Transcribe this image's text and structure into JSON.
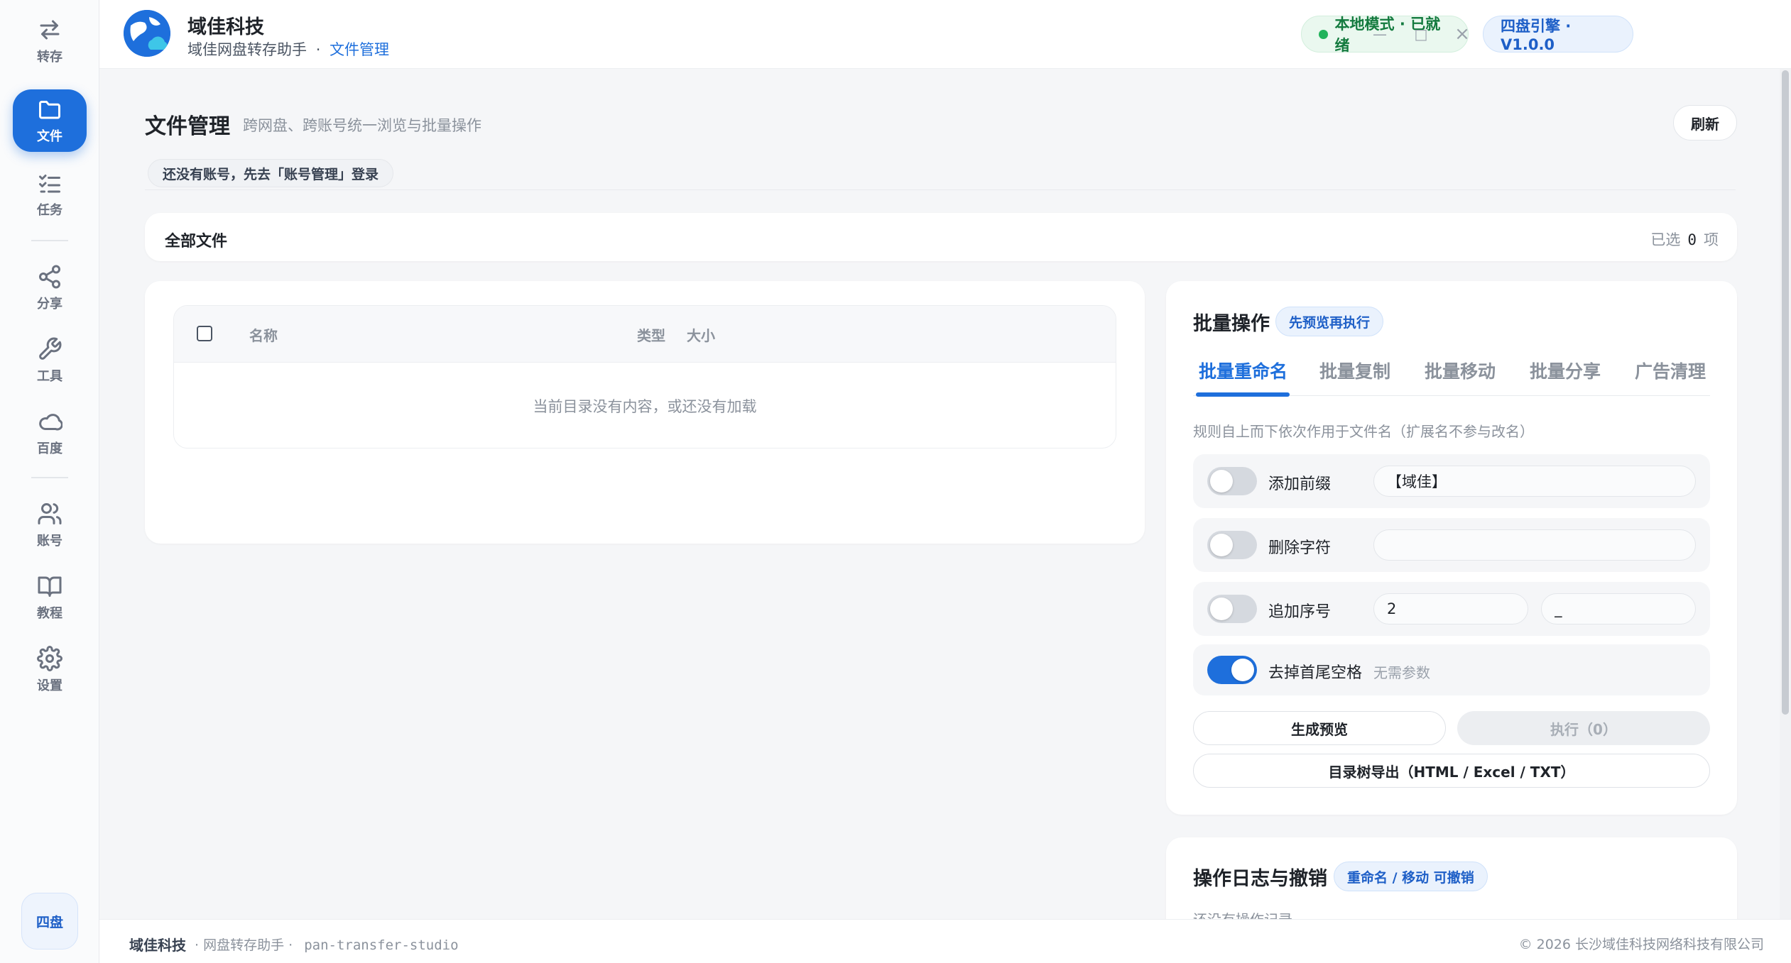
{
  "app": {
    "title": "域佳科技",
    "subtitle": "域佳网盘转存助手",
    "separator": "·",
    "current_page": "文件管理"
  },
  "header": {
    "status_label": "本地模式 · 已就绪",
    "engine_label": "四盘引擎 · V1.0.0",
    "status_color": "#22b35b",
    "accent_color": "#1e6fdc"
  },
  "window_controls": {
    "minimize": "—",
    "maximize": "□",
    "close": "×"
  },
  "sidebar": {
    "items": [
      {
        "label": "转存",
        "icon": "transfer-icon",
        "active": false
      },
      {
        "label": "文件",
        "icon": "folder-icon",
        "active": true
      },
      {
        "label": "任务",
        "icon": "task-list-icon",
        "active": false
      },
      {
        "label": "分享",
        "icon": "share-icon",
        "active": false
      },
      {
        "label": "工具",
        "icon": "wrench-icon",
        "active": false
      },
      {
        "label": "百度",
        "icon": "cloud-icon",
        "active": false
      },
      {
        "label": "账号",
        "icon": "users-icon",
        "active": false
      },
      {
        "label": "教程",
        "icon": "book-icon",
        "active": false
      },
      {
        "label": "设置",
        "icon": "gear-icon",
        "active": false
      }
    ],
    "engine_chip": "四盘"
  },
  "page": {
    "title": "文件管理",
    "description": "跨网盘、跨账号统一浏览与批量操作",
    "refresh_label": "刷新",
    "notice": "还没有账号，先去「账号管理」登录"
  },
  "pathbar": {
    "label": "全部文件",
    "selected_prefix": "已选",
    "selected_count": "0",
    "selected_suffix": "项"
  },
  "file_table": {
    "columns": [
      "名称",
      "类型",
      "大小"
    ],
    "rows": [],
    "empty_text": "当前目录没有内容，或还没有加载"
  },
  "batch": {
    "title": "批量操作",
    "badge": "先预览再执行",
    "tabs": [
      "批量重命名",
      "批量复制",
      "批量移动",
      "批量分享",
      "广告清理"
    ],
    "active_tab": 0,
    "hint": "规则自上而下依次作用于文件名（扩展名不参与改名）",
    "rules": {
      "prefix": {
        "label": "添加前缀",
        "enabled": false,
        "value": "【域佳】"
      },
      "delete_chars": {
        "label": "删除字符",
        "enabled": false,
        "value": ""
      },
      "sequence": {
        "label": "追加序号",
        "enabled": false,
        "start": "2",
        "separator": "_"
      },
      "trim": {
        "label": "去掉首尾空格",
        "enabled": true,
        "note": "无需参数"
      }
    },
    "preview_label": "生成预览",
    "execute_label": "执行（0）",
    "export_label": "目录树导出（HTML / Excel / TXT）"
  },
  "log": {
    "title": "操作日志与撤销",
    "badge": "重命名 / 移动 可撤销",
    "empty_text": "还没有操作记录"
  },
  "footer": {
    "brand": "域佳科技",
    "product": "· 网盘转存助手 ·",
    "package": "pan-transfer-studio",
    "copyright": "© 2026 长沙域佳科技网络科技有限公司"
  }
}
